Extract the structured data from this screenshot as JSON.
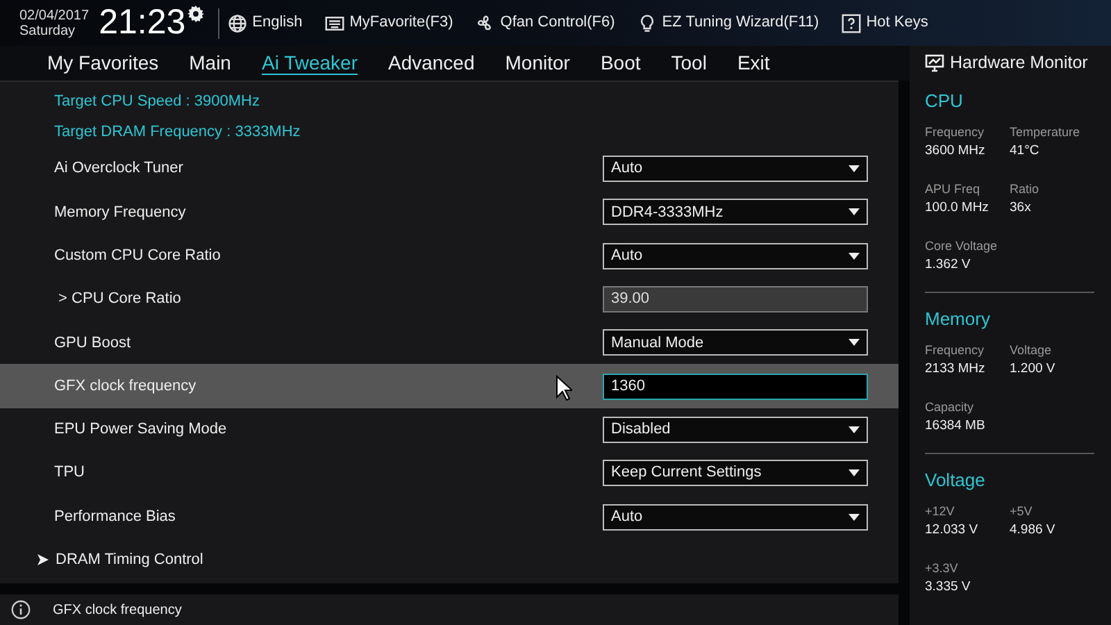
{
  "header": {
    "date": "02/04/2017",
    "day": "Saturday",
    "time": "21:23",
    "shortcuts": [
      {
        "kind": "language",
        "label": "English"
      },
      {
        "kind": "favorite",
        "label": "MyFavorite(F3)"
      },
      {
        "kind": "fan",
        "label": "Qfan Control(F6)"
      },
      {
        "kind": "wizard",
        "label": "EZ Tuning Wizard(F11)"
      },
      {
        "kind": "help",
        "label": "Hot Keys"
      }
    ]
  },
  "tabs": [
    {
      "label": "My Favorites",
      "selected": false
    },
    {
      "label": "Main",
      "selected": false
    },
    {
      "label": "Ai Tweaker",
      "selected": true
    },
    {
      "label": "Advanced",
      "selected": false
    },
    {
      "label": "Monitor",
      "selected": false
    },
    {
      "label": "Boot",
      "selected": false
    },
    {
      "label": "Tool",
      "selected": false
    },
    {
      "label": "Exit",
      "selected": false
    }
  ],
  "info_lines": [
    "Target CPU Speed : 3900MHz",
    "Target DRAM Frequency : 3333MHz"
  ],
  "settings": [
    {
      "kind": "dropdown",
      "label": "Ai Overclock Tuner",
      "value": "Auto",
      "selected": false
    },
    {
      "kind": "dropdown",
      "label": "Memory Frequency",
      "value": "DDR4-3333MHz",
      "selected": false
    },
    {
      "kind": "dropdown",
      "label": "Custom CPU Core Ratio",
      "value": "Auto",
      "selected": false
    },
    {
      "kind": "readonly",
      "label": " > CPU Core Ratio",
      "value": "39.00",
      "selected": false
    },
    {
      "kind": "dropdown",
      "label": "GPU Boost",
      "value": "Manual Mode",
      "selected": false
    },
    {
      "kind": "input",
      "label": "GFX clock frequency",
      "value": "1360",
      "selected": true
    },
    {
      "kind": "dropdown",
      "label": "EPU Power Saving Mode",
      "value": "Disabled",
      "selected": false
    },
    {
      "kind": "dropdown",
      "label": "TPU",
      "value": "Keep Current Settings",
      "selected": false
    },
    {
      "kind": "dropdown",
      "label": "Performance Bias",
      "value": "Auto",
      "selected": false
    },
    {
      "kind": "submenu",
      "label": "DRAM Timing Control",
      "selected": false
    }
  ],
  "help_text": "GFX clock frequency",
  "hardware_monitor": {
    "title": "Hardware Monitor",
    "sections": [
      {
        "title": "CPU",
        "items": [
          {
            "label": "Frequency",
            "value": "3600 MHz"
          },
          {
            "label": "Temperature",
            "value": "41°C"
          },
          {
            "label": "APU Freq",
            "value": "100.0 MHz"
          },
          {
            "label": "Ratio",
            "value": "36x"
          },
          {
            "label": "Core Voltage",
            "value": "1.362 V"
          }
        ]
      },
      {
        "title": "Memory",
        "items": [
          {
            "label": "Frequency",
            "value": "2133 MHz"
          },
          {
            "label": "Voltage",
            "value": "1.200 V"
          },
          {
            "label": "Capacity",
            "value": "16384 MB"
          }
        ]
      },
      {
        "title": "Voltage",
        "items": [
          {
            "label": "+12V",
            "value": "12.033 V"
          },
          {
            "label": "+5V",
            "value": "4.986 V"
          },
          {
            "label": "+3.3V",
            "value": "3.335 V"
          }
        ]
      }
    ]
  }
}
